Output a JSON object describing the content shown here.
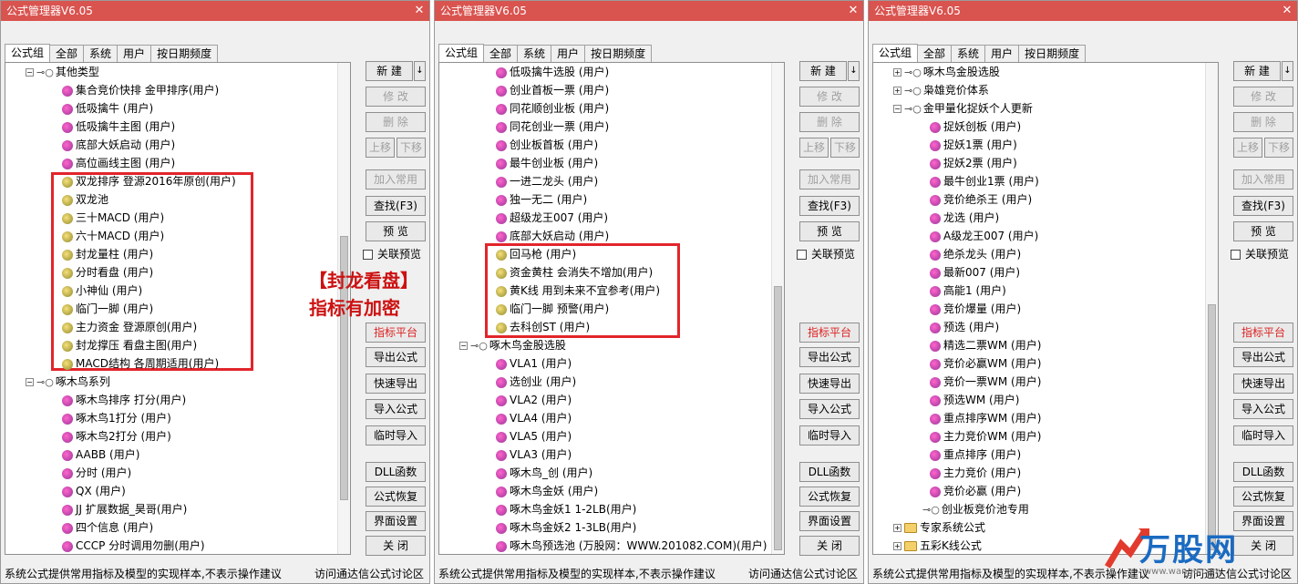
{
  "win1": {
    "title": "公式管理器V6.05",
    "tabs": [
      "公式组",
      "全部",
      "系统",
      "用户",
      "按日期频度"
    ],
    "rows": [
      {
        "t": "其他类型",
        "kind": "group",
        "exp": "-"
      },
      {
        "t": "集合竞价快排 金甲排序(用户)",
        "kind": "pink"
      },
      {
        "t": "低吸擒牛 (用户)",
        "kind": "pink"
      },
      {
        "t": "低吸擒牛主图 (用户)",
        "kind": "pink"
      },
      {
        "t": "底部大妖启动 (用户)",
        "kind": "pink"
      },
      {
        "t": "高位画线主图 (用户)",
        "kind": "pink"
      },
      {
        "t": "双龙排序 登源2016年原创(用户)",
        "kind": "lock"
      },
      {
        "t": "双龙池",
        "kind": "lock"
      },
      {
        "t": "三十MACD (用户)",
        "kind": "lock"
      },
      {
        "t": "六十MACD (用户)",
        "kind": "lock"
      },
      {
        "t": "封龙量柱 (用户)",
        "kind": "lock"
      },
      {
        "t": "分时看盘 (用户)",
        "kind": "lock"
      },
      {
        "t": "小神仙 (用户)",
        "kind": "lock"
      },
      {
        "t": "临门一脚 (用户)",
        "kind": "lock"
      },
      {
        "t": "主力资金 登源原创(用户)",
        "kind": "lock"
      },
      {
        "t": "封龙撑压 看盘主图(用户)",
        "kind": "lock"
      },
      {
        "t": "MACD结构 各周期适用(用户)",
        "kind": "lock"
      },
      {
        "t": "啄木鸟系列",
        "kind": "group",
        "exp": "-"
      },
      {
        "t": "啄木鸟排序 打分(用户)",
        "kind": "pink"
      },
      {
        "t": "啄木鸟1打分 (用户)",
        "kind": "pink"
      },
      {
        "t": "啄木鸟2打分 (用户)",
        "kind": "pink"
      },
      {
        "t": "AABB (用户)",
        "kind": "pink"
      },
      {
        "t": "分时 (用户)",
        "kind": "pink"
      },
      {
        "t": "QX (用户)",
        "kind": "pink"
      },
      {
        "t": "JJ 扩展数据_昊哥(用户)",
        "kind": "pink"
      },
      {
        "t": "四个信息 (用户)",
        "kind": "pink"
      },
      {
        "t": "CCCP 分时调用勿删(用户)",
        "kind": "pink"
      }
    ],
    "overlay1": "【封龙看盘】",
    "overlay2": "指标有加密"
  },
  "win2": {
    "title": "公式管理器V6.05",
    "tabs": [
      "公式组",
      "全部",
      "系统",
      "用户",
      "按日期频度"
    ],
    "rows": [
      {
        "t": "低吸擒牛选股 (用户)",
        "kind": "pink"
      },
      {
        "t": "创业首板一票 (用户)",
        "kind": "pink"
      },
      {
        "t": "同花顺创业板 (用户)",
        "kind": "pink"
      },
      {
        "t": "同花创业一票 (用户)",
        "kind": "pink"
      },
      {
        "t": "创业板首板 (用户)",
        "kind": "pink"
      },
      {
        "t": "最牛创业板 (用户)",
        "kind": "pink"
      },
      {
        "t": "一进二龙头 (用户)",
        "kind": "pink"
      },
      {
        "t": "独一无二 (用户)",
        "kind": "pink"
      },
      {
        "t": "超级龙王007 (用户)",
        "kind": "pink"
      },
      {
        "t": "底部大妖启动 (用户)",
        "kind": "pink"
      },
      {
        "t": "回马枪 (用户)",
        "kind": "lock"
      },
      {
        "t": "资金黄柱 会消失不增加(用户)",
        "kind": "lock"
      },
      {
        "t": "黄K线 用到未来不宜参考(用户)",
        "kind": "lock"
      },
      {
        "t": "临门一脚 预警(用户)",
        "kind": "lock"
      },
      {
        "t": "去科创ST (用户)",
        "kind": "lock"
      },
      {
        "t": "啄木鸟金股选股",
        "kind": "group",
        "exp": "-"
      },
      {
        "t": "VLA1 (用户)",
        "kind": "pink"
      },
      {
        "t": "选创业 (用户)",
        "kind": "pink"
      },
      {
        "t": "VLA2 (用户)",
        "kind": "pink"
      },
      {
        "t": "VLA4 (用户)",
        "kind": "pink"
      },
      {
        "t": "VLA5 (用户)",
        "kind": "pink"
      },
      {
        "t": "VLA3 (用户)",
        "kind": "pink"
      },
      {
        "t": "啄木鸟_创 (用户)",
        "kind": "pink"
      },
      {
        "t": "啄木鸟金妖 (用户)",
        "kind": "pink"
      },
      {
        "t": "啄木鸟金妖1 1-2LB(用户)",
        "kind": "pink"
      },
      {
        "t": "啄木鸟金妖2 1-3LB(用户)",
        "kind": "pink"
      },
      {
        "t": "啄木鸟预选池 (万股网：WWW.201082.COM)(用户)",
        "kind": "pink"
      }
    ]
  },
  "win3": {
    "title": "公式管理器V6.05",
    "tabs": [
      "公式组",
      "全部",
      "系统",
      "用户",
      "按日期频度"
    ],
    "rows": [
      {
        "t": "啄木鸟金股选股",
        "kind": "group",
        "exp": "+"
      },
      {
        "t": "枭雄竞价体系",
        "kind": "group",
        "exp": "+"
      },
      {
        "t": "金甲量化捉妖个人更新",
        "kind": "group",
        "exp": "-"
      },
      {
        "t": "捉妖创板 (用户)",
        "kind": "pink"
      },
      {
        "t": "捉妖1票 (用户)",
        "kind": "pink"
      },
      {
        "t": "捉妖2票 (用户)",
        "kind": "pink"
      },
      {
        "t": "最牛创业1票 (用户)",
        "kind": "pink"
      },
      {
        "t": "竞价绝杀王 (用户)",
        "kind": "pink"
      },
      {
        "t": "龙选 (用户)",
        "kind": "pink"
      },
      {
        "t": "A级龙王007 (用户)",
        "kind": "pink"
      },
      {
        "t": "绝杀龙头 (用户)",
        "kind": "pink"
      },
      {
        "t": "最新007 (用户)",
        "kind": "pink"
      },
      {
        "t": "高能1 (用户)",
        "kind": "pink"
      },
      {
        "t": "竞价爆量 (用户)",
        "kind": "pink"
      },
      {
        "t": "预选 (用户)",
        "kind": "pink"
      },
      {
        "t": "精选二票WM (用户)",
        "kind": "pink"
      },
      {
        "t": "竞价必赢WM (用户)",
        "kind": "pink"
      },
      {
        "t": "竞价一票WM (用户)",
        "kind": "pink"
      },
      {
        "t": "预选WM (用户)",
        "kind": "pink"
      },
      {
        "t": "重点排序WM (用户)",
        "kind": "pink"
      },
      {
        "t": "主力竞价WM (用户)",
        "kind": "pink"
      },
      {
        "t": "重点排序 (用户)",
        "kind": "pink"
      },
      {
        "t": "主力竞价 (用户)",
        "kind": "pink"
      },
      {
        "t": "竞价必赢 (用户)",
        "kind": "pink"
      },
      {
        "t": "创业板竞价池专用",
        "kind": "group",
        "exp": ""
      },
      {
        "t": "专家系统公式",
        "kind": "folder",
        "exp": "+"
      },
      {
        "t": "五彩K线公式",
        "kind": "folder",
        "exp": "+"
      }
    ]
  },
  "buttons": {
    "new": "新 建",
    "edit": "修 改",
    "delete": "删 除",
    "move_up": "上移",
    "move_down": "下移",
    "add_common": "加入常用",
    "find": "查找(F3)",
    "preview": "预 览",
    "related_preview": "关联预览",
    "indicator_platform": "指标平台",
    "export": "导出公式",
    "quick_export": "快速导出",
    "import": "导入公式",
    "temp_import": "临时导入",
    "dll": "DLL函数",
    "restore": "公式恢复",
    "ui_settings": "界面设置",
    "close": "关 闭"
  },
  "status": {
    "left": "系统公式提供常用指标及模型的实现样本,不表示操作建议",
    "right": "访问通达信公式讨论区"
  },
  "logo": {
    "text": "万股网",
    "url": "www.wangu.com"
  },
  "colors": {
    "title_bar": "#d9534f",
    "highlight_box": "#e2252b",
    "overlay_text": "#cc1111"
  }
}
